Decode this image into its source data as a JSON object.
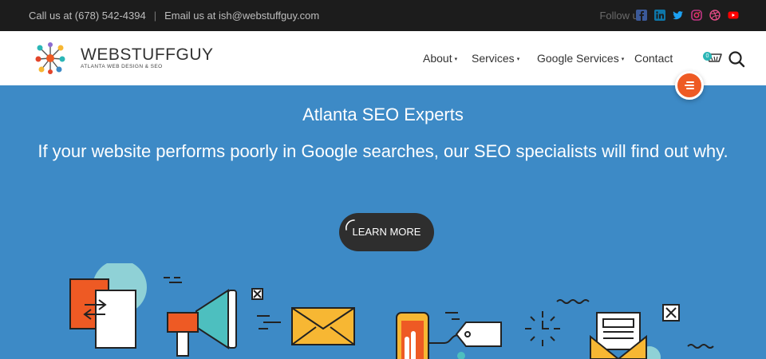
{
  "topbar": {
    "phone": "Call us at (678) 542-4394",
    "separator": "|",
    "email": "Email us at ish@webstuffguy.com",
    "follow_label": "Follow us:",
    "social": [
      "facebook-icon",
      "linkedin-icon",
      "twitter-icon",
      "instagram-icon",
      "dribbble-icon",
      "youtube-icon"
    ]
  },
  "header": {
    "brand": "WEBSTUFFGUY",
    "tagline": "ATLANTA WEB DESIGN & SEO",
    "nav": [
      {
        "label": "About",
        "dropdown": true
      },
      {
        "label": "Services",
        "dropdown": true
      },
      {
        "label": "Google Services",
        "dropdown": true
      },
      {
        "label": "Contact",
        "dropdown": false
      }
    ],
    "cart_count": "0"
  },
  "hero": {
    "title": "Atlanta SEO Experts",
    "subtitle": "If your website performs poorly in Google searches, our SEO specialists will find out why.",
    "button": "LEARN MORE"
  },
  "colors": {
    "topbar_bg": "#1c1c1c",
    "hero_bg": "#3d8ac6",
    "accent_orange": "#ee5a24",
    "teal": "#2bb6b6",
    "yellow": "#f7b733",
    "button_bg": "#2e2e2e"
  }
}
